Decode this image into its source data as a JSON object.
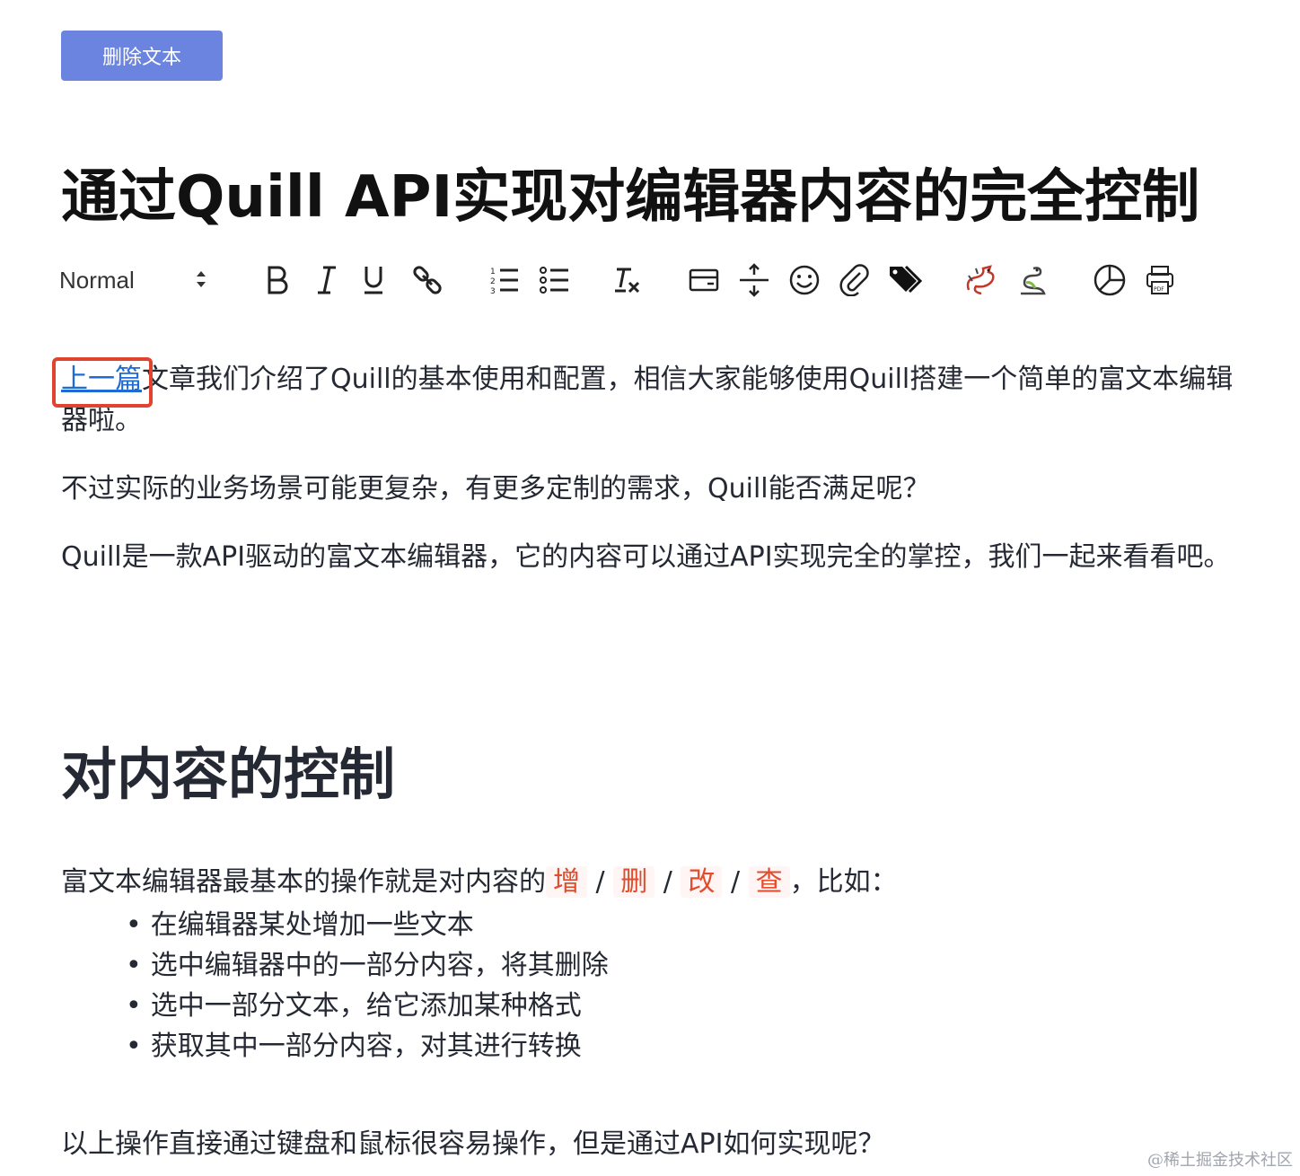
{
  "action_button": {
    "label": "删除文本"
  },
  "document": {
    "title": "通过Quill API实现对编辑器内容的完全控制",
    "intro": {
      "link_text": "上一篇",
      "rest": "文章我们介绍了Quill的基本使用和配置，相信大家能够使用Quill搭建一个简单的富文本编辑器啦。"
    },
    "para2": "不过实际的业务场景可能更复杂，有更多定制的需求，Quill能否满足呢？",
    "para3": "Quill是一款API驱动的富文本编辑器，它的内容可以通过API实现完全的掌控，我们一起来看看吧。",
    "section_heading": "对内容的控制",
    "section_para": {
      "prefix": "富文本编辑器最基本的操作就是对内容的",
      "codes": [
        "增",
        "删",
        "改",
        "查"
      ],
      "separator": "/",
      "suffix": "，比如："
    },
    "list_items": [
      "在编辑器某处增加一些文本",
      "选中编辑器中的一部分内容，将其删除",
      "选中一部分文本，给它添加某种格式",
      "获取其中一部分内容，对其进行转换"
    ],
    "closing": "以上操作直接通过键盘和鼠标很容易操作，但是通过API如何实现呢？"
  },
  "toolbar": {
    "header_select_value": "Normal",
    "icons": [
      "bold-icon",
      "italic-icon",
      "underline-icon",
      "link-icon",
      "ordered-list-icon",
      "bullet-list-icon",
      "clean-format-icon",
      "card-icon",
      "divider-icon",
      "emoji-icon",
      "attachment-icon",
      "tag-icon",
      "dragon-icon",
      "snake-icon",
      "pie-chart-icon",
      "pdf-printer-icon"
    ]
  },
  "watermark": "@稀土掘金技术社区",
  "colors": {
    "button": "#6b84e0",
    "link": "#1e6bd6",
    "highlight_box": "#e0442f",
    "code_text": "#e24b2b",
    "code_bg": "#fff5f5"
  }
}
